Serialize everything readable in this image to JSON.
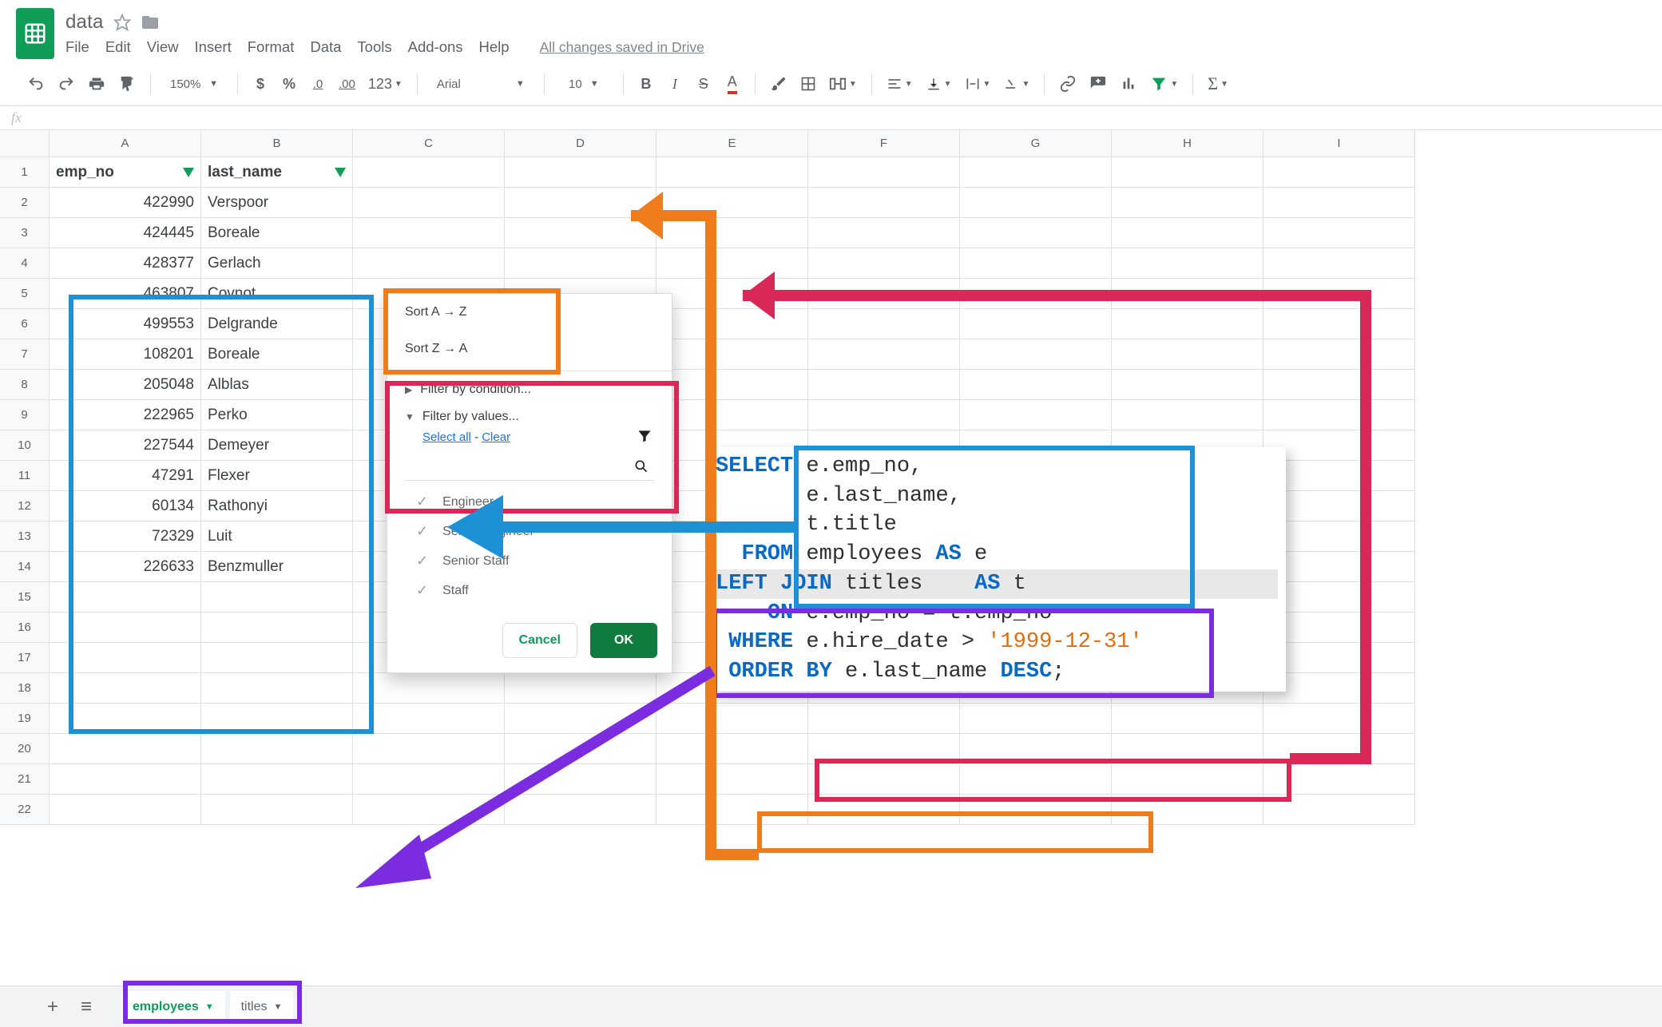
{
  "doc": {
    "title": "data",
    "saved_message": "All changes saved in Drive"
  },
  "menus": [
    "File",
    "Edit",
    "View",
    "Insert",
    "Format",
    "Data",
    "Tools",
    "Add-ons",
    "Help"
  ],
  "toolbar": {
    "zoom": "150%",
    "font": "Arial",
    "font_size": "10",
    "decrease_decimal": ".0",
    "increase_decimal": ".00",
    "format_number": "123"
  },
  "formula_bar": {
    "fx_label": "fx"
  },
  "columns": [
    "A",
    "B",
    "C",
    "D",
    "E",
    "F",
    "G",
    "H",
    "I"
  ],
  "data_headers": {
    "col_a": "emp_no",
    "col_b": "last_name"
  },
  "rows": [
    {
      "emp_no": "422990",
      "last_name": "Verspoor"
    },
    {
      "emp_no": "424445",
      "last_name": "Boreale"
    },
    {
      "emp_no": "428377",
      "last_name": "Gerlach"
    },
    {
      "emp_no": "463807",
      "last_name": "Covnot"
    },
    {
      "emp_no": "499553",
      "last_name": "Delgrande"
    },
    {
      "emp_no": "108201",
      "last_name": "Boreale"
    },
    {
      "emp_no": "205048",
      "last_name": "Alblas"
    },
    {
      "emp_no": "222965",
      "last_name": "Perko"
    },
    {
      "emp_no": "227544",
      "last_name": "Demeyer"
    },
    {
      "emp_no": "47291",
      "last_name": "Flexer"
    },
    {
      "emp_no": "60134",
      "last_name": "Rathonyi"
    },
    {
      "emp_no": "72329",
      "last_name": "Luit"
    },
    {
      "emp_no": "226633",
      "last_name": "Benzmuller"
    }
  ],
  "visible_row_numbers": [
    "1",
    "2",
    "3",
    "4",
    "5",
    "6",
    "7",
    "8",
    "9",
    "10",
    "11",
    "12",
    "13",
    "14",
    "15",
    "16",
    "17",
    "18",
    "19",
    "20",
    "21",
    "22"
  ],
  "filter_popup": {
    "sort_az": "Sort A → Z",
    "sort_za": "Sort Z → A",
    "filter_condition": "Filter by condition...",
    "filter_values": "Filter by values...",
    "select_all": "Select all",
    "dash": " - ",
    "clear": "Clear",
    "values": [
      "Engineer",
      "Senior Engineer",
      "Senior Staff",
      "Staff"
    ],
    "cancel": "Cancel",
    "ok": "OK"
  },
  "sql": {
    "l1": "SELECT e.emp_no,",
    "l2": "       e.last_name,",
    "l3": "       t.title",
    "l4": "  FROM employees AS e",
    "l5": "LEFT JOIN titles    AS t",
    "l6": "    ON e.emp_no = t.emp_no",
    "l7": " WHERE e.hire_date > '1999-12-31'",
    "l8": " ORDER BY e.last_name DESC;"
  },
  "tabs": {
    "active": "employees",
    "other": "titles"
  }
}
